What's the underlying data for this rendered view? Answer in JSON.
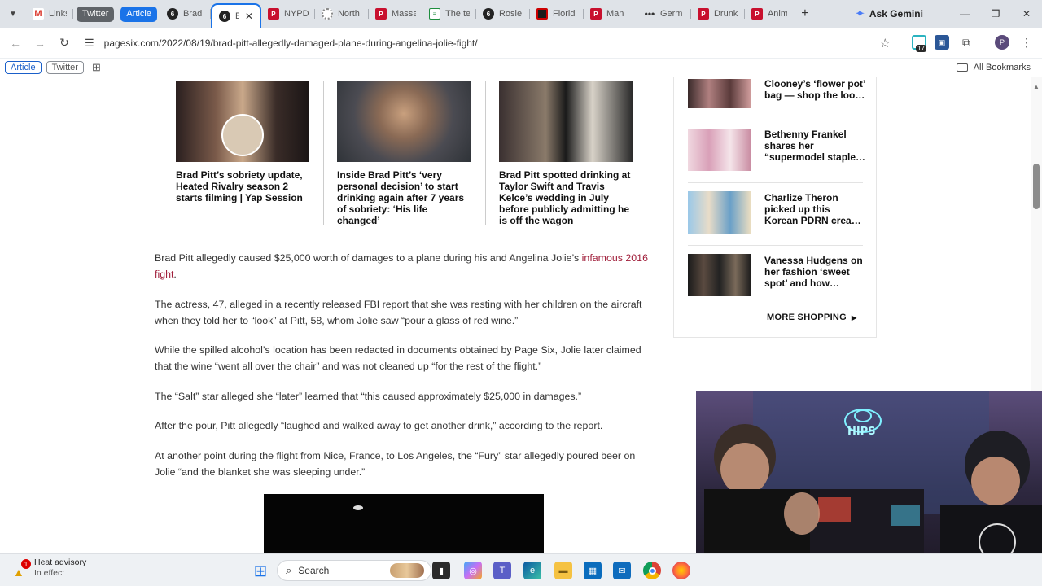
{
  "tabs": {
    "groups": [
      {
        "label": "Twitter",
        "color": "#5f6368"
      },
      {
        "label": "Article",
        "color": "#1a73e8"
      }
    ],
    "items": [
      {
        "label": "Links",
        "icon": "gmail-icon"
      },
      {
        "label": "Brad",
        "icon": "pagesix-icon"
      },
      {
        "label": "B",
        "icon": "pagesix-icon"
      },
      {
        "label": "NYPD",
        "icon": "nypost-icon"
      },
      {
        "label": "North",
        "icon": "loader-icon"
      },
      {
        "label": "Massa",
        "icon": "nypost-icon"
      },
      {
        "label": "The te",
        "icon": "doc-icon"
      },
      {
        "label": "Rosie",
        "icon": "pagesix-icon"
      },
      {
        "label": "Florid",
        "icon": "florida-icon"
      },
      {
        "label": "Man",
        "icon": "nypost-icon"
      },
      {
        "label": "Germ",
        "icon": "dots-icon"
      },
      {
        "label": "Drunk",
        "icon": "nypost-icon"
      },
      {
        "label": "Anim",
        "icon": "nypost-icon"
      }
    ],
    "ask_gemini": "Ask Gemini"
  },
  "toolbar": {
    "url": "pagesix.com/2022/08/19/brad-pitt-allegedly-damaged-plane-during-angelina-jolie-fight/",
    "ext_badge": "17",
    "profile": "P"
  },
  "bookmarks": {
    "items": [
      "Article",
      "Twitter"
    ],
    "all_bookmarks": "All Bookmarks"
  },
  "related": [
    "Brad Pitt’s sobriety update, Heated Rivalry season 2 starts filming | Yap Session",
    "Inside Brad Pitt’s ‘very personal decision’ to start drinking again after 7 years of sobriety: ‘His life changed’",
    "Brad Pitt spotted drinking at Taylor Swift and Travis Kelce’s wedding in July before publicly admitting he is off the wagon"
  ],
  "article": {
    "p1_text": "Brad Pitt allegedly caused $25,000 worth of damages to a plane during his and Angelina Jolie’s ",
    "p1_link": "infamous 2016 fight",
    "p1_end": ".",
    "p2": "The actress, 47, alleged in a recently released FBI report that she was resting with her children on the aircraft when they told her to “look” at Pitt, 58, whom Jolie saw “pour a glass of red wine.”",
    "p3": "While the spilled alcohol’s location has been redacted in documents obtained by Page Six, Jolie later claimed that the wine “went all over the chair” and was not cleaned up “for the rest of the flight.”",
    "p4": "The “Salt” star alleged she “later” learned that “this caused approximately $25,000 in damages.”",
    "p5": "After the pour, Pitt allegedly “laughed and walked away to get another drink,” according to the report.",
    "p6": "At another point during the flight from Nice, France, to Los Angeles, the “Fury” star allegedly poured beer on Jolie “and the blanket she was sleeping under.”"
  },
  "shopping": {
    "items": [
      "Clooney’s ‘flower pot’ bag — shop the loo…",
      "Bethenny Frankel shares her “supermodel staple…",
      "Charlize Theron picked up this Korean PDRN crea…",
      "Vanessa Hudgens on her fashion ‘sweet spot’ and how…"
    ],
    "more": "MORE SHOPPING"
  },
  "webcam": {
    "neon": "HIPS"
  },
  "taskbar": {
    "weather_title": "Heat advisory",
    "weather_sub": "In effect",
    "weather_badge": "1",
    "search": "Search"
  }
}
